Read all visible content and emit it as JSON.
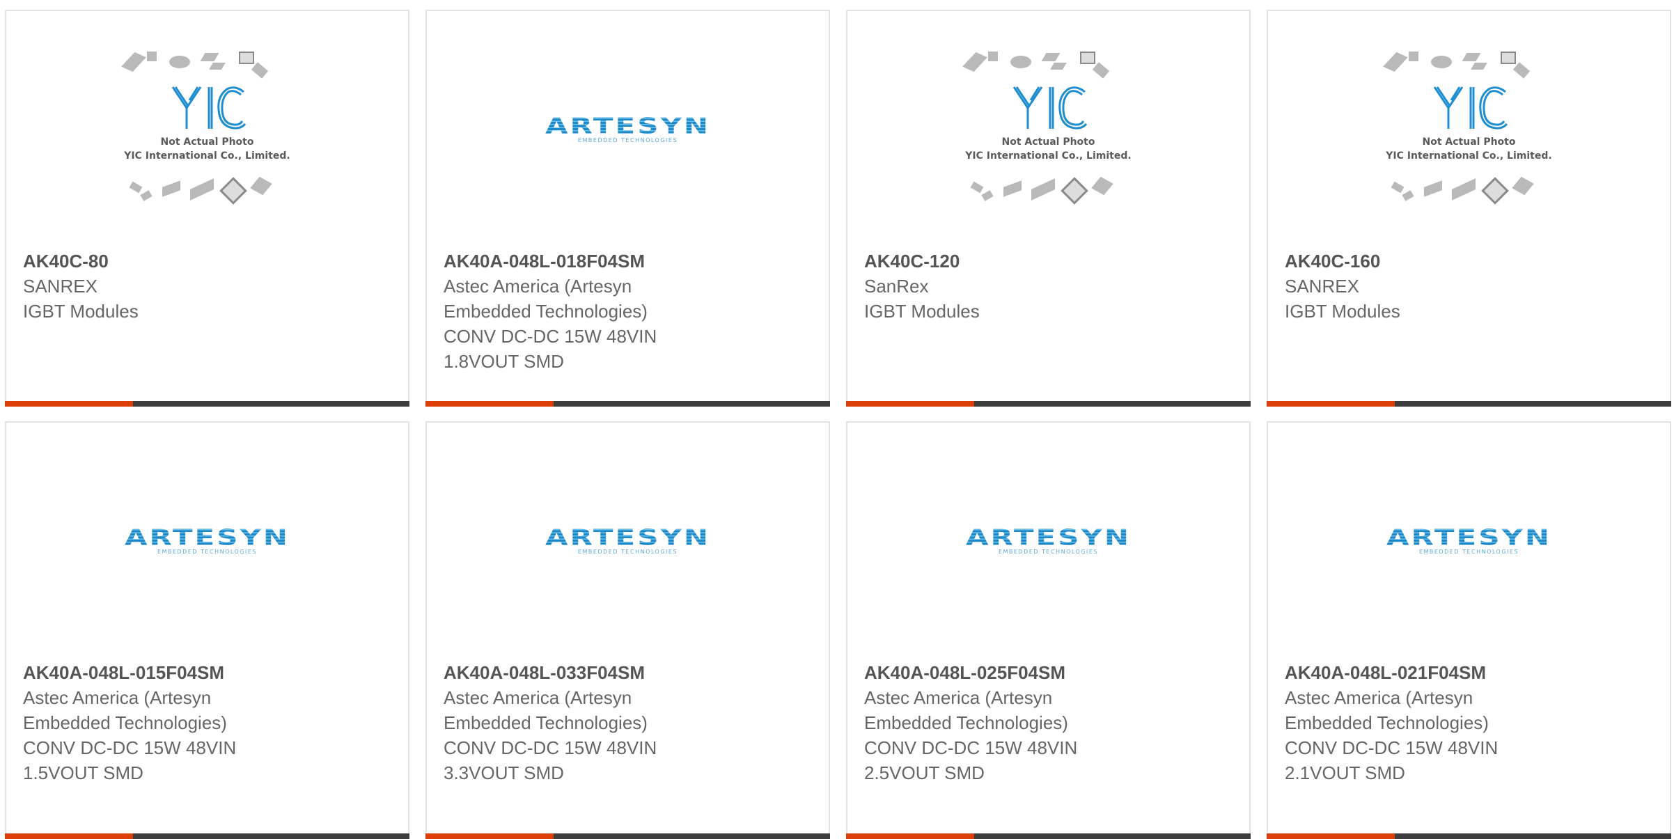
{
  "cards": [
    {
      "part": "AK40C-80",
      "lines": [
        "SANREX",
        "IGBT Modules"
      ],
      "image": "yic-placeholder"
    },
    {
      "part": "AK40A-048L-018F04SM",
      "lines": [
        "Astec America (Artesyn",
        "Embedded Technologies)",
        "CONV DC-DC 15W 48VIN",
        "1.8VOUT SMD"
      ],
      "image": "artesyn-logo"
    },
    {
      "part": "AK40C-120",
      "lines": [
        "SanRex",
        "IGBT Modules"
      ],
      "image": "yic-placeholder"
    },
    {
      "part": "AK40C-160",
      "lines": [
        "SANREX",
        "IGBT Modules"
      ],
      "image": "yic-placeholder"
    },
    {
      "part": "AK40A-048L-015F04SM",
      "lines": [
        "Astec America (Artesyn",
        "Embedded Technologies)",
        "CONV DC-DC 15W 48VIN",
        "1.5VOUT SMD"
      ],
      "image": "artesyn-logo"
    },
    {
      "part": "AK40A-048L-033F04SM",
      "lines": [
        "Astec America (Artesyn",
        "Embedded Technologies)",
        "CONV DC-DC 15W 48VIN",
        "3.3VOUT SMD"
      ],
      "image": "artesyn-logo"
    },
    {
      "part": "AK40A-048L-025F04SM",
      "lines": [
        "Astec America (Artesyn",
        "Embedded Technologies)",
        "CONV DC-DC 15W 48VIN",
        "2.5VOUT SMD"
      ],
      "image": "artesyn-logo"
    },
    {
      "part": "AK40A-048L-021F04SM",
      "lines": [
        "Astec America (Artesyn",
        "Embedded Technologies)",
        "CONV DC-DC 15W 48VIN",
        "2.1VOUT SMD"
      ],
      "image": "artesyn-logo"
    }
  ],
  "yic_placeholder": {
    "logo_text": "YIC",
    "caption_line1": "Not Actual Photo",
    "caption_line2": "YIC International Co., Limited."
  },
  "artesyn_logo": {
    "word": "ARTESYN",
    "sub": "EMBEDDED TECHNOLOGIES"
  },
  "colors": {
    "accent_bar": "#dd3f08",
    "dark_bar": "#3c3c3c",
    "text": "#666666",
    "logo_blue": "#1e88c6"
  }
}
